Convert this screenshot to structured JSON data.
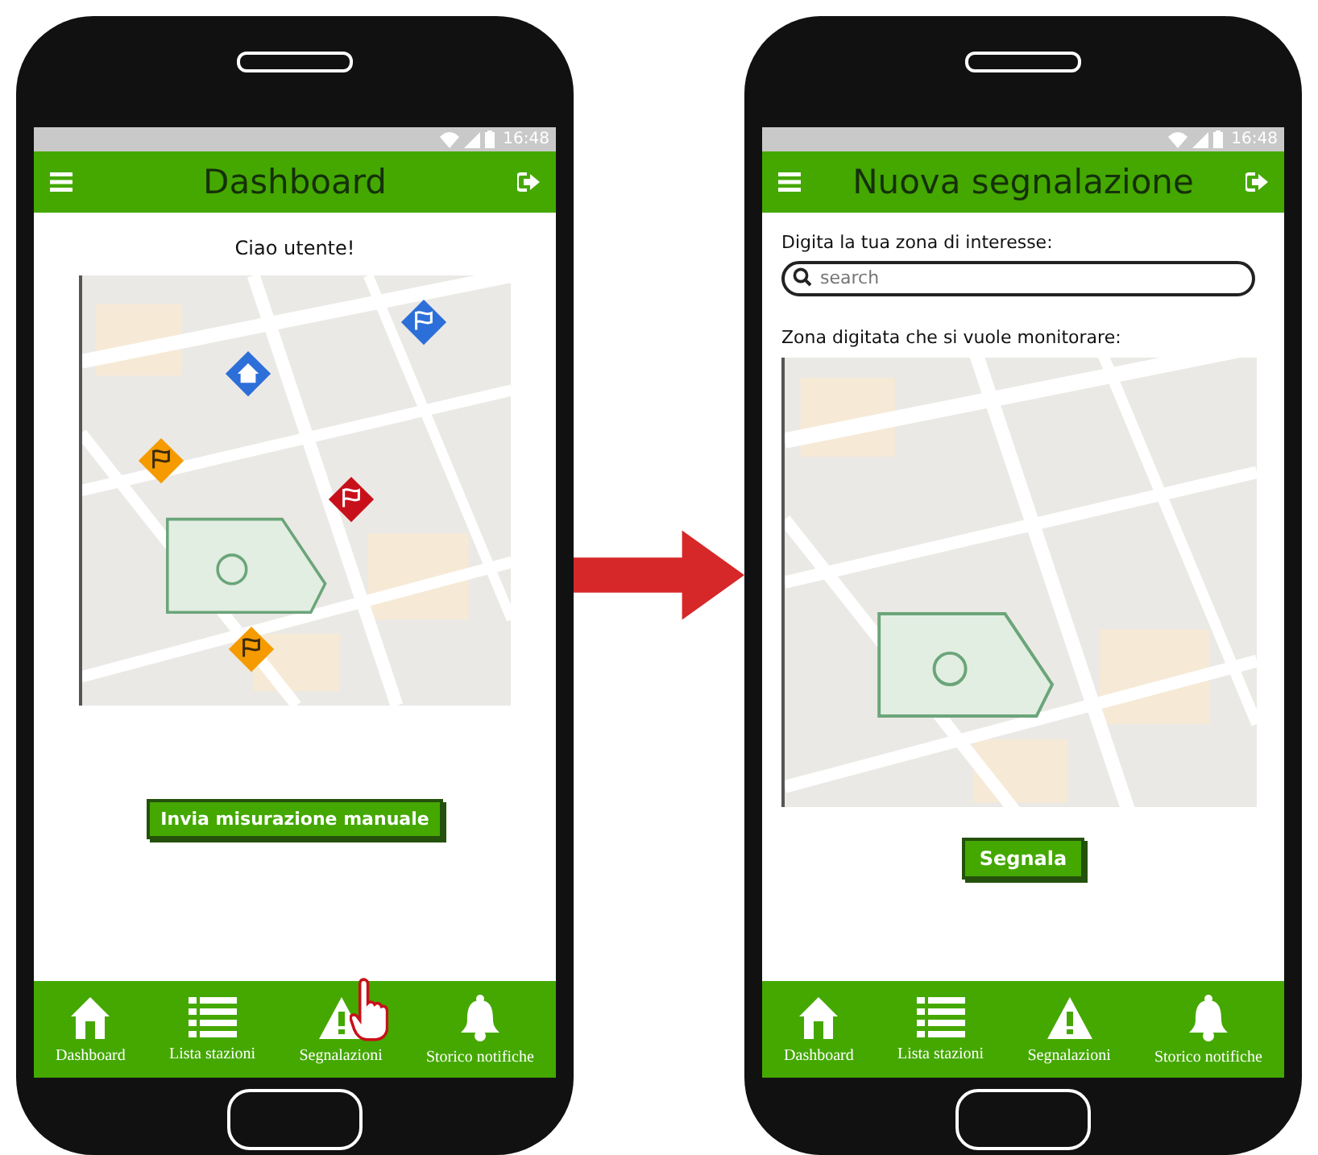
{
  "phones": [
    {
      "status_bar": {
        "time": "16:48"
      },
      "header": {
        "title": "Dashboard"
      },
      "pointer_cursor": true,
      "content": {
        "kind": "dashboard",
        "greeting": "Ciao utente!",
        "map": {
          "kind": "picture",
          "markers": [
            {
              "kind": "flag",
              "color": "#2d6fd8"
            },
            {
              "kind": "home",
              "color": "#2d6fd8"
            },
            {
              "kind": "flag",
              "color": "#f59b00"
            },
            {
              "kind": "flag",
              "color": "#c8101a"
            },
            {
              "kind": "flag",
              "color": "#f59b00"
            }
          ]
        },
        "button": "Invia misurazione manuale"
      },
      "nav": [
        {
          "kind": "home",
          "label": "Dashboard"
        },
        {
          "kind": "list",
          "label": "Lista stazioni"
        },
        {
          "kind": "warning",
          "label": "Segnalazioni"
        },
        {
          "kind": "bell",
          "label": "Storico notifiche"
        }
      ]
    },
    {
      "status_bar": {
        "time": "16:48"
      },
      "header": {
        "title": "Nuova segnalazione"
      },
      "pointer_cursor": false,
      "content": {
        "kind": "report",
        "search_label": "Digita la tua zona di interesse:",
        "search": {
          "placeholder": "search"
        },
        "map_label": "Zona digitata che si vuole monitorare:",
        "button": "Segnala"
      },
      "nav": [
        {
          "kind": "home",
          "label": "Dashboard"
        },
        {
          "kind": "list",
          "label": "Lista stazioni"
        },
        {
          "kind": "warning",
          "label": "Segnalazioni"
        },
        {
          "kind": "bell",
          "label": "Storico notifiche"
        }
      ]
    }
  ]
}
